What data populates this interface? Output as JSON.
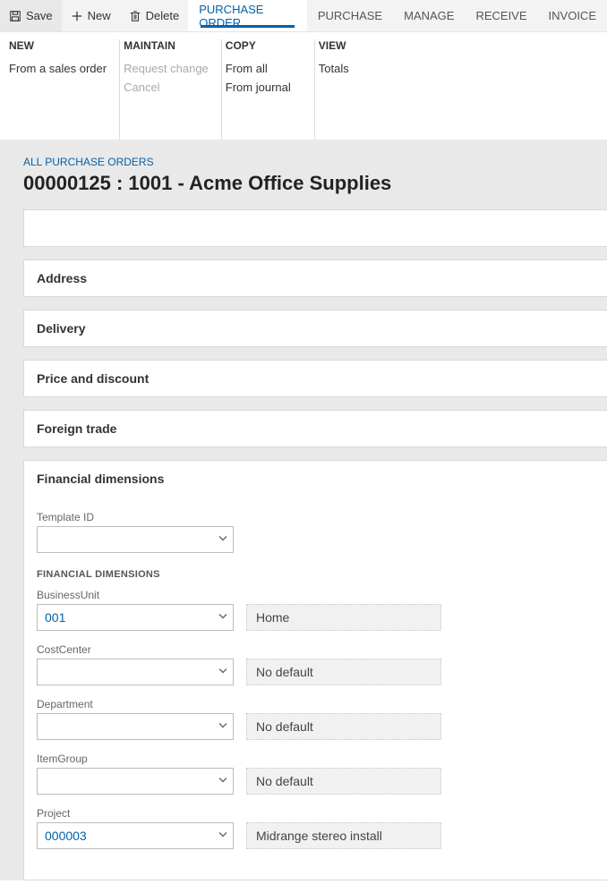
{
  "toolbar": {
    "save": "Save",
    "new": "New",
    "delete": "Delete"
  },
  "tabs": {
    "purchase_order": "PURCHASE ORDER",
    "purchase": "PURCHASE",
    "manage": "MANAGE",
    "receive": "RECEIVE",
    "invoice": "INVOICE"
  },
  "ribbon": {
    "new": {
      "header": "NEW",
      "from_sales_order": "From a sales order"
    },
    "maintain": {
      "header": "MAINTAIN",
      "request_change": "Request change",
      "cancel": "Cancel"
    },
    "copy": {
      "header": "COPY",
      "from_all": "From all",
      "from_journal": "From journal"
    },
    "view": {
      "header": "VIEW",
      "totals": "Totals"
    }
  },
  "breadcrumb": "ALL PURCHASE ORDERS",
  "page_title": "00000125 : 1001 - Acme Office Supplies",
  "fasttabs": {
    "address": "Address",
    "delivery": "Delivery",
    "price_discount": "Price and discount",
    "foreign_trade": "Foreign trade",
    "financial_dimensions": "Financial dimensions"
  },
  "fd": {
    "template_label": "Template ID",
    "template_value": "",
    "subheading": "FINANCIAL DIMENSIONS",
    "dims": [
      {
        "label": "BusinessUnit",
        "value": "001",
        "desc": "Home"
      },
      {
        "label": "CostCenter",
        "value": "",
        "desc": "No default"
      },
      {
        "label": "Department",
        "value": "",
        "desc": "No default"
      },
      {
        "label": "ItemGroup",
        "value": "",
        "desc": "No default"
      },
      {
        "label": "Project",
        "value": "000003",
        "desc": "Midrange stereo install"
      }
    ]
  }
}
